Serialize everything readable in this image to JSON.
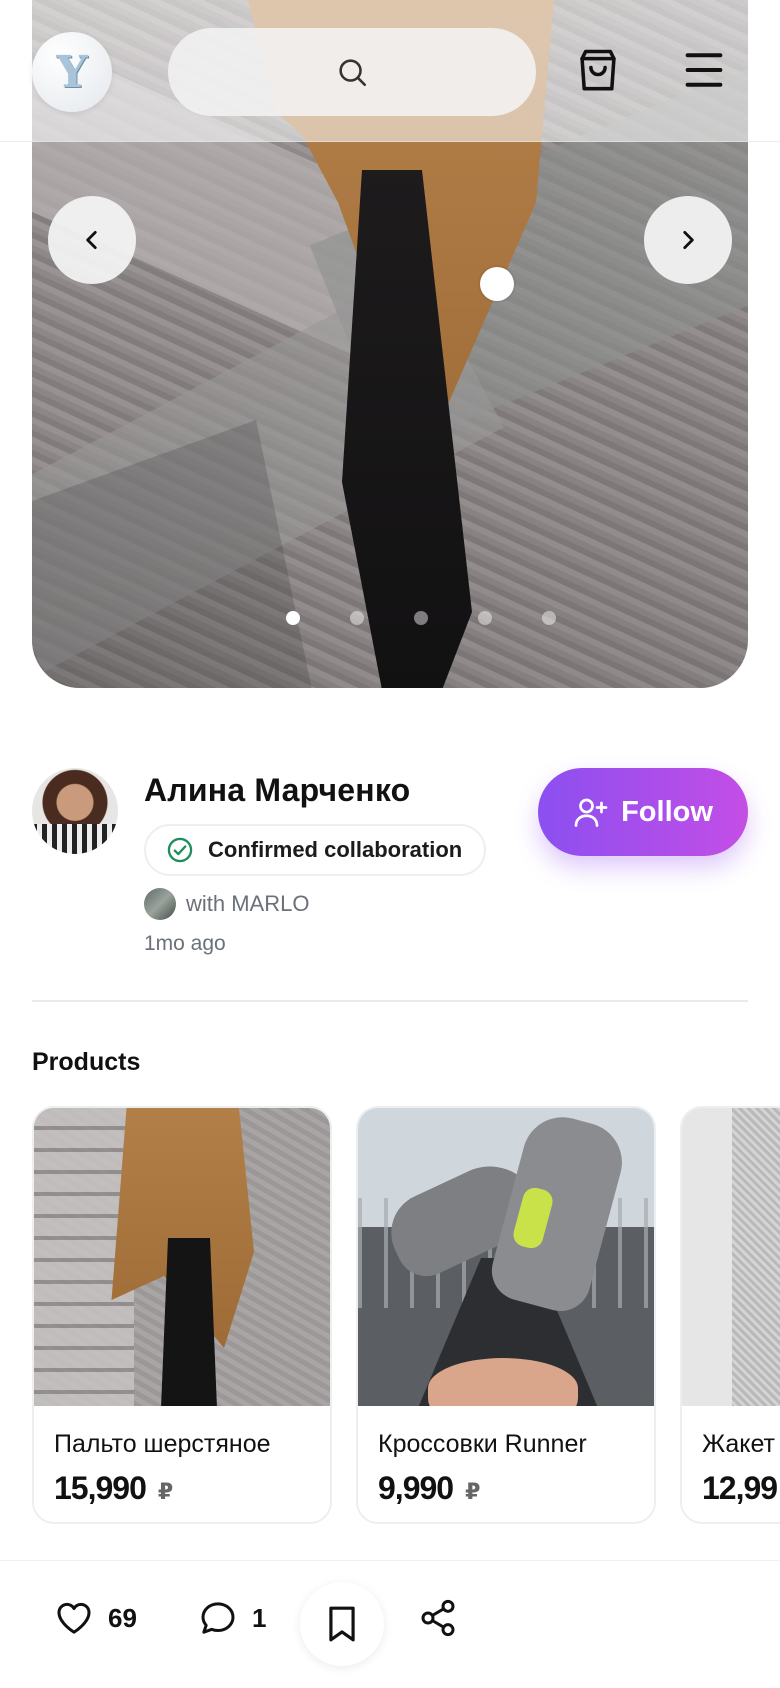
{
  "header": {
    "logo_letter": "Y",
    "icons": [
      "search-icon",
      "shopping-bag-icon",
      "menu-icon"
    ]
  },
  "hero": {
    "slide_count": 5,
    "active_slide": 1,
    "icons": [
      "chevron-left-icon",
      "chevron-right-icon"
    ]
  },
  "author": {
    "name": "Алина Марченко",
    "collaboration_label": "Confirmed collaboration",
    "with_text": "with MARLO",
    "time_ago": "1mo ago",
    "follow_label": "Follow"
  },
  "products": {
    "title": "Products",
    "items": [
      {
        "name": "Пальто шерстяное",
        "price": "15,990",
        "currency": "₽"
      },
      {
        "name": "Кроссовки Runner",
        "price": "9,990",
        "currency": "₽"
      },
      {
        "name": "Жакет",
        "price": "12,99",
        "currency": ""
      }
    ]
  },
  "actions": {
    "likes": "69",
    "comments": "1",
    "icons": [
      "heart-icon",
      "comment-icon",
      "bookmark-icon",
      "share-icon"
    ]
  },
  "colors": {
    "accent_start": "#8b4ff0",
    "accent_end": "#c44ee6",
    "verified": "#1e8e5a"
  }
}
